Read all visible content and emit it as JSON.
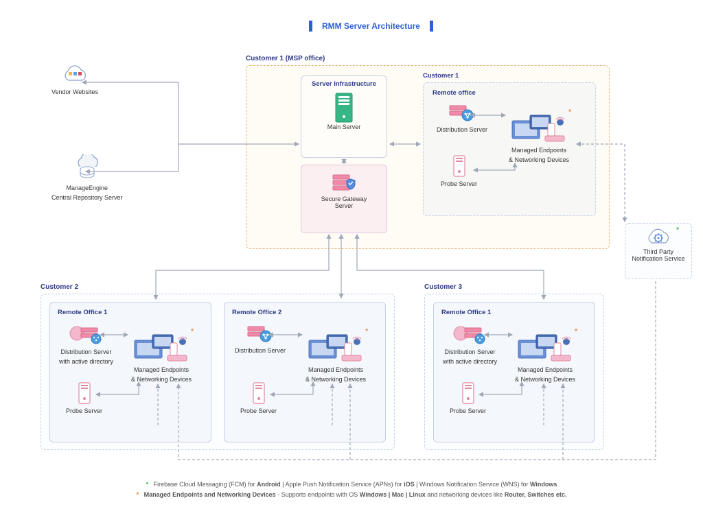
{
  "title": "RMM Server Architecture",
  "left": {
    "vendor_websites": "Vendor Websites",
    "crs_line1": "ManageEngine",
    "crs_line2": "Central Repository Server"
  },
  "msp": {
    "header": "Customer 1 (MSP office)",
    "infra_header": "Server Infrastructure",
    "main_server": "Main Server",
    "secure_gw_line1": "Secure Gateway",
    "secure_gw_line2": "Server",
    "cust1_header": "Customer 1",
    "remote_office": "Remote office",
    "dist_server": "Distribution Server",
    "probe_server": "Probe Server",
    "endpoints_line1": "Managed Endpoints",
    "endpoints_line2": "& Networking Devices"
  },
  "third_party": {
    "line1": "Third Party",
    "line2": "Notification Service"
  },
  "cust2": {
    "header": "Customer 2",
    "ro1": "Remote Office 1",
    "ro2": "Remote Office 2",
    "dist_ad_line1": "Distribution Server",
    "dist_ad_line2": "with active directory",
    "dist_server": "Distribution Server",
    "probe_server": "Probe Server",
    "endpoints_line1": "Managed Endpoints",
    "endpoints_line2": "& Networking Devices"
  },
  "cust3": {
    "header": "Customer 3",
    "ro1": "Remote Office 1",
    "dist_ad_line1": "Distribution Server",
    "dist_ad_line2": "with active directory",
    "probe_server": "Probe Server",
    "endpoints_line1": "Managed Endpoints",
    "endpoints_line2": "& Networking Devices"
  },
  "footer": {
    "fcm_prefix": "Firebase Cloud Messaging (FCM) for ",
    "android": "Android",
    "sep": "   |   ",
    "apns_prefix": "Apple Push Notification Service (APNs) for ",
    "ios": "iOS",
    "wns_prefix": "Windows Notification Service (WNS) for ",
    "windows": "Windows",
    "l2_prefix": "Managed Endpoints and Networking Devices",
    "l2_mid": " - Supports endpoints with OS ",
    "l2_os": "Windows | Mac | Linux",
    "l2_suffix1": " and networking devices like ",
    "l2_suffix2": "Router, Switches etc."
  }
}
